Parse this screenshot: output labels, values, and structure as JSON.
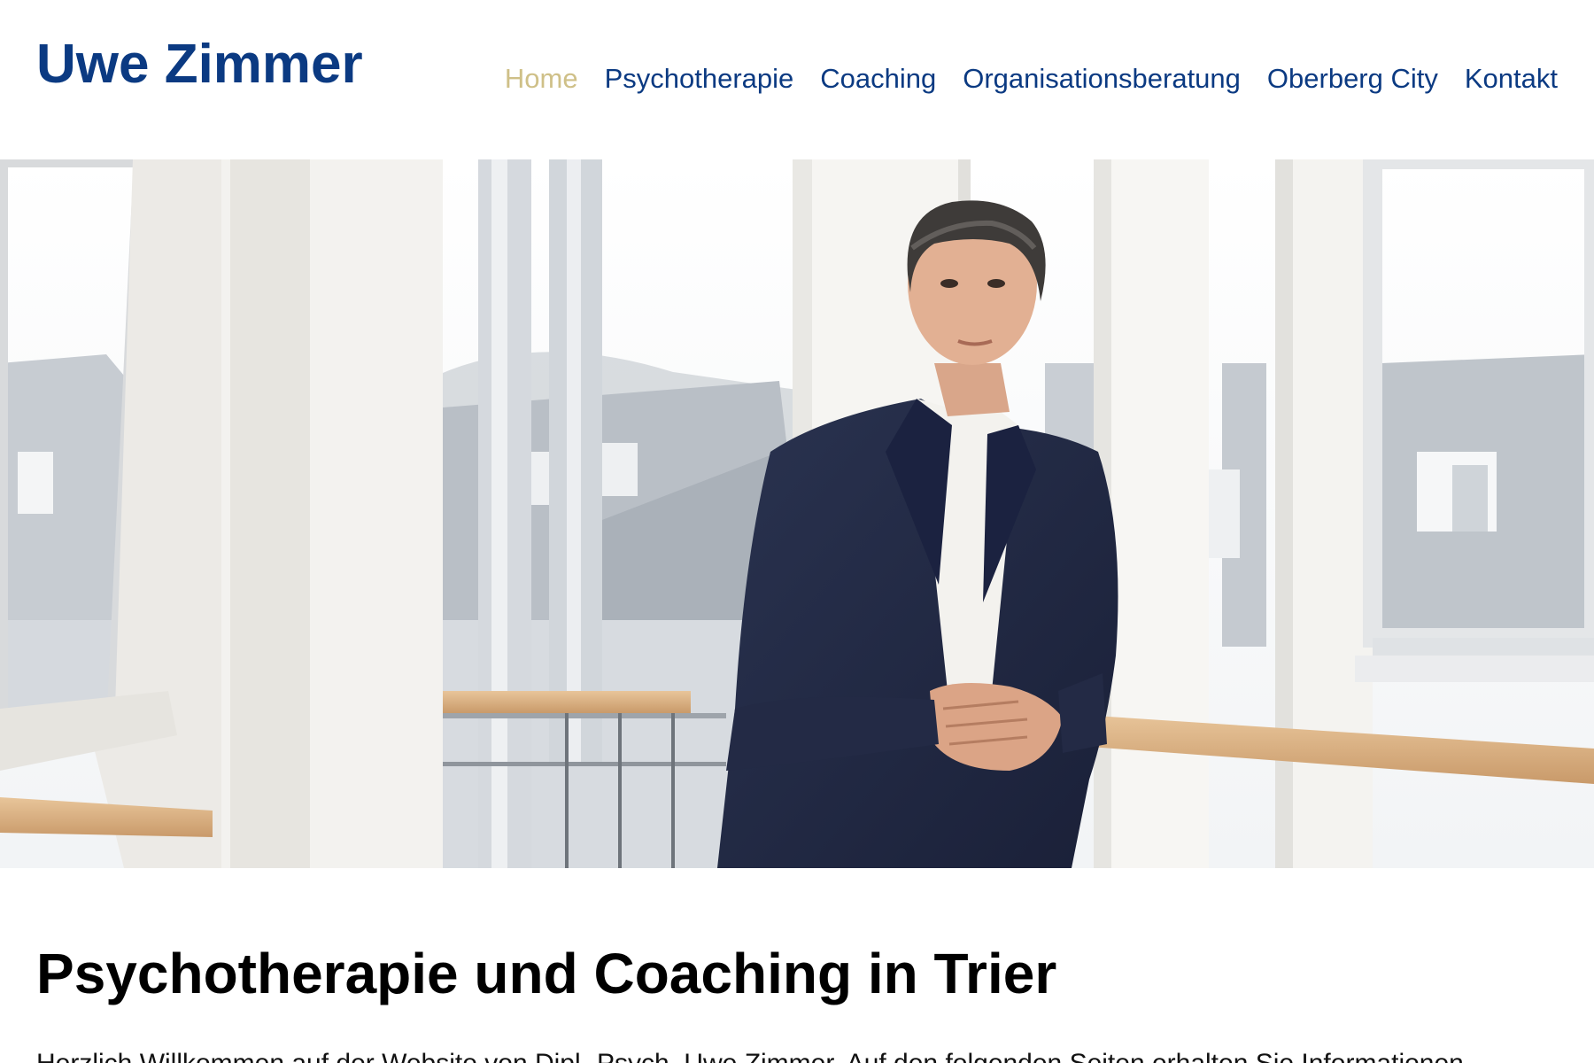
{
  "header": {
    "logo": "Uwe Zimmer",
    "nav": [
      {
        "label": "Home",
        "active": true
      },
      {
        "label": "Psychotherapie",
        "active": false
      },
      {
        "label": "Coaching",
        "active": false
      },
      {
        "label": "Organisationsberatung",
        "active": false
      },
      {
        "label": "Oberberg City",
        "active": false
      },
      {
        "label": "Kontakt",
        "active": false
      }
    ]
  },
  "hero": {
    "description": "portrait photo in bright office with windows"
  },
  "main": {
    "title": "Psychotherapie und Coaching in Trier",
    "intro": "Herzlich Willkommen auf der Website von Dipl.-Psych. Uwe Zimmer. Auf den folgenden Seiten erhalten Sie Informationen"
  },
  "colors": {
    "brand": "#0b3a82",
    "nav_active": "#cfc088",
    "text": "#000000"
  }
}
